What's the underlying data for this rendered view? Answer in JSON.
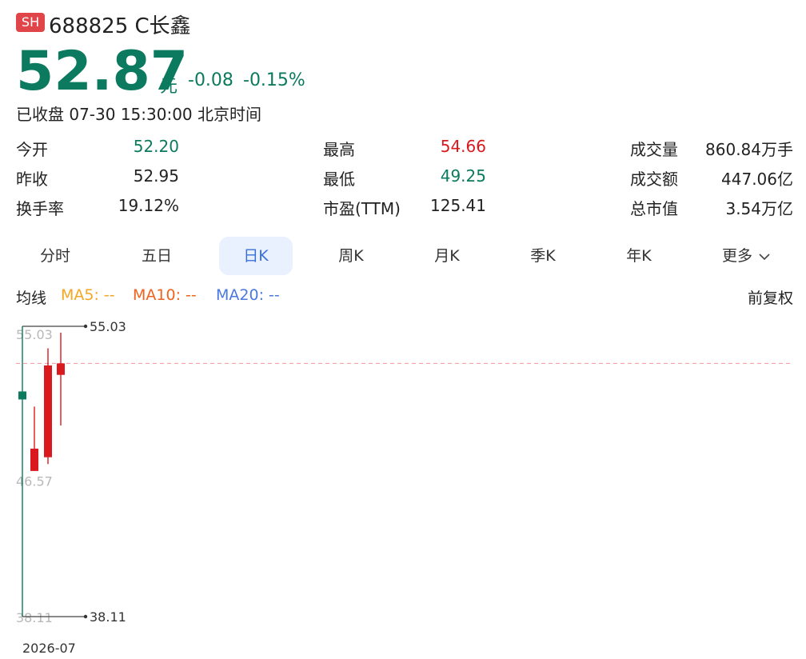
{
  "header": {
    "badge": "SH",
    "title": "688825 C长鑫",
    "price": "52.87",
    "unit": "元",
    "change": "-0.08",
    "change_pct": "-0.15%",
    "status": "已收盘 07-30 15:30:00 北京时间"
  },
  "stats": [
    {
      "label": "今开",
      "value": "52.20",
      "color": "#0b7a5e"
    },
    {
      "label": "昨收",
      "value": "52.95",
      "color": "#222222"
    },
    {
      "label": "换手率",
      "value": "19.12%",
      "color": "#222222"
    },
    {
      "label": "最高",
      "value": "54.66",
      "color": "#d9191e"
    },
    {
      "label": "最低",
      "value": "49.25",
      "color": "#0b7a5e"
    },
    {
      "label": "市盈(TTM)",
      "value": "125.41",
      "color": "#222222"
    },
    {
      "label": "成交量",
      "value": "860.84万手",
      "color": "#222222"
    },
    {
      "label": "成交额",
      "value": "447.06亿",
      "color": "#222222"
    },
    {
      "label": "总市值",
      "value": "3.54万亿",
      "color": "#222222"
    }
  ],
  "tabs": [
    {
      "label": "分时"
    },
    {
      "label": "五日"
    },
    {
      "label": "日K",
      "active": true
    },
    {
      "label": "周K"
    },
    {
      "label": "月K"
    },
    {
      "label": "季K"
    },
    {
      "label": "年K"
    },
    {
      "label": "更多"
    }
  ],
  "ma": {
    "label": "均线",
    "ma5": "MA5: --",
    "ma10": "MA10: --",
    "ma20": "MA20: --",
    "adjust": "前复权"
  },
  "colors": {
    "up": "#d9191e",
    "down": "#0b7a5e",
    "badge": "#e0454a",
    "ma5": "#f5a623",
    "ma10": "#f0631e",
    "ma20": "#4a78e0",
    "dashed": "#f09a9a"
  },
  "chart_data": {
    "type": "candlestick",
    "ylim": [
      38.11,
      55.03
    ],
    "y_tick_labels": [
      "55.03",
      "46.57",
      "38.11"
    ],
    "max_label": "55.03",
    "min_label": "38.11",
    "x_tick_labels": [
      "2026-07"
    ],
    "last_close_line": 52.87,
    "candles": [
      {
        "open": 38.11,
        "close": 51.0,
        "high": 55.03,
        "low": 38.11
      },
      {
        "open": 47.9,
        "close": 46.6,
        "high": 50.35,
        "low": 46.6
      },
      {
        "open": 47.4,
        "close": 52.75,
        "high": 53.75,
        "low": 47.0
      },
      {
        "open": 52.2,
        "close": 52.87,
        "high": 54.66,
        "low": 49.25
      }
    ]
  }
}
